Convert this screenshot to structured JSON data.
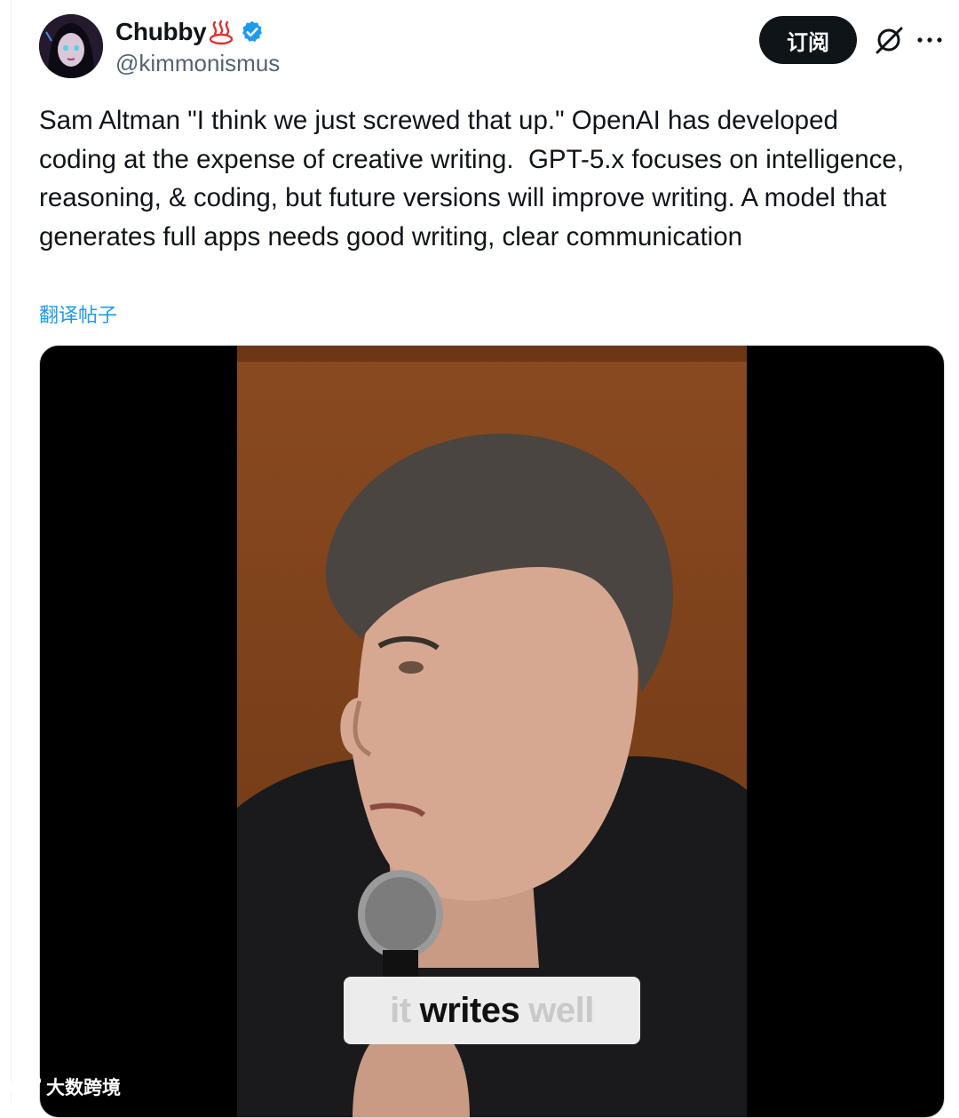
{
  "author": {
    "display_name": "Chubby",
    "handle": "@kimmonismus",
    "verified": true,
    "emoji_icon": "hot-springs-icon"
  },
  "actions": {
    "subscribe_label": "订阅",
    "grok_icon": "grok-icon",
    "more_icon": "more-dots-icon"
  },
  "tweet": {
    "text": "Sam Altman \"I think we just screwed that up.\" OpenAI has developed coding at the expense of creative writing.  GPT-5.x focuses on intelligence, reasoning, & coding, but future versions will improve writing. A model that generates full apps needs good writing, clear communication",
    "translate_label": "翻译帖子"
  },
  "media": {
    "caption_prefix": "it",
    "caption_main": "writes",
    "caption_suffix": "well"
  },
  "watermark": {
    "text": "大数跨境"
  },
  "colors": {
    "accent": "#1d9bf0",
    "text_primary": "#0f1419",
    "text_secondary": "#536471",
    "button_bg": "#0f1419"
  }
}
